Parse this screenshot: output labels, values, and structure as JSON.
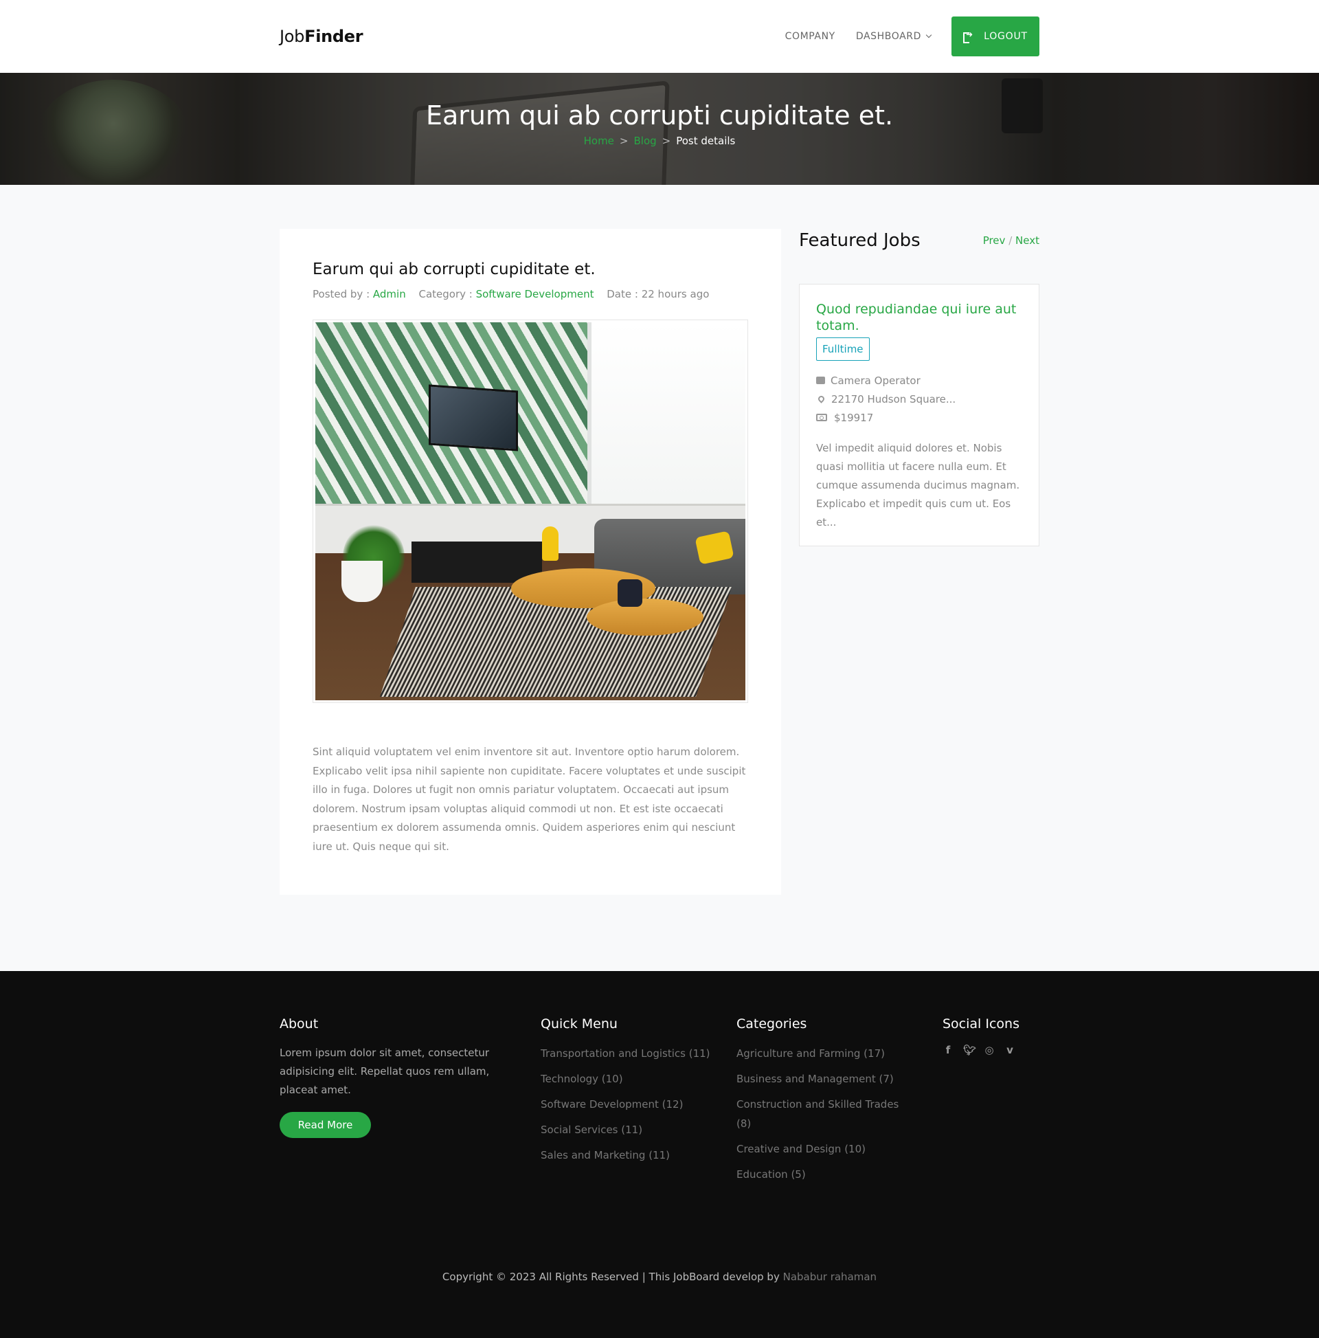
{
  "header": {
    "logo_light": "Job",
    "logo_bold": "Finder",
    "nav": {
      "company": "COMPANY",
      "dashboard": "DASHBOARD"
    },
    "logout_label": "LOGOUT"
  },
  "hero": {
    "title": "Earum qui ab corrupti cupiditate et.",
    "breadcrumb": {
      "home": "Home",
      "blog": "Blog",
      "sep": ">",
      "current": "Post details"
    }
  },
  "post": {
    "title": "Earum qui ab corrupti cupiditate et.",
    "meta": {
      "posted_by_label": "Posted by : ",
      "author": "Admin",
      "category_label": "Category : ",
      "category": "Software Development",
      "date_label": "Date : ",
      "date": "22 hours ago"
    },
    "body": "Sint aliquid voluptatem vel enim inventore sit aut. Inventore optio harum dolorem. Explicabo velit ipsa nihil sapiente non cupiditate. Facere voluptates et unde suscipit illo in fuga. Dolores ut fugit non omnis pariatur voluptatem. Occaecati aut ipsum dolorem. Nostrum ipsam voluptas aliquid commodi ut non. Et est iste occaecati praesentium ex dolorem assumenda omnis. Quidem asperiores enim qui nesciunt iure ut. Quis neque qui sit."
  },
  "sidebar": {
    "title": "Featured Jobs",
    "prev": "Prev",
    "slash": "/",
    "next": "Next",
    "job": {
      "title": "Quod repudiandae qui iure aut totam.",
      "type": "Fulltime",
      "position": "Camera Operator",
      "location": "22170 Hudson Square...",
      "salary": "$19917",
      "description": "Vel impedit aliquid dolores et. Nobis quasi mollitia ut facere nulla eum. Et cumque assumenda ducimus magnam. Explicabo et impedit quis cum ut. Eos et..."
    }
  },
  "footer": {
    "about": {
      "title": "About",
      "text": "Lorem ipsum dolor sit amet, consectetur adipisicing elit. Repellat quos rem ullam, placeat amet.",
      "button": "Read More"
    },
    "quick_menu": {
      "title": "Quick Menu",
      "items": [
        "Transportation and Logistics (11)",
        "Technology (10)",
        "Software Development (12)",
        "Social Services (11)",
        "Sales and Marketing (11)"
      ]
    },
    "categories": {
      "title": "Categories",
      "items": [
        "Agriculture and Farming (17)",
        "Business and Management (7)",
        "Construction and Skilled Trades (8)",
        "Creative and Design (10)",
        "Education (5)"
      ]
    },
    "social": {
      "title": "Social Icons",
      "icons": [
        "facebook-icon",
        "twitter-icon",
        "instagram-icon",
        "vimeo-icon"
      ]
    },
    "copyright_text": "Copyright © 2023 All Rights Reserved | This JobBoard develop by ",
    "copyright_author": "Nababur rahaman"
  },
  "colors": {
    "accent": "#28a745",
    "badge": "#17a2b8",
    "footer_bg": "#0d0d0d",
    "page_bg": "#f8f9fa"
  }
}
